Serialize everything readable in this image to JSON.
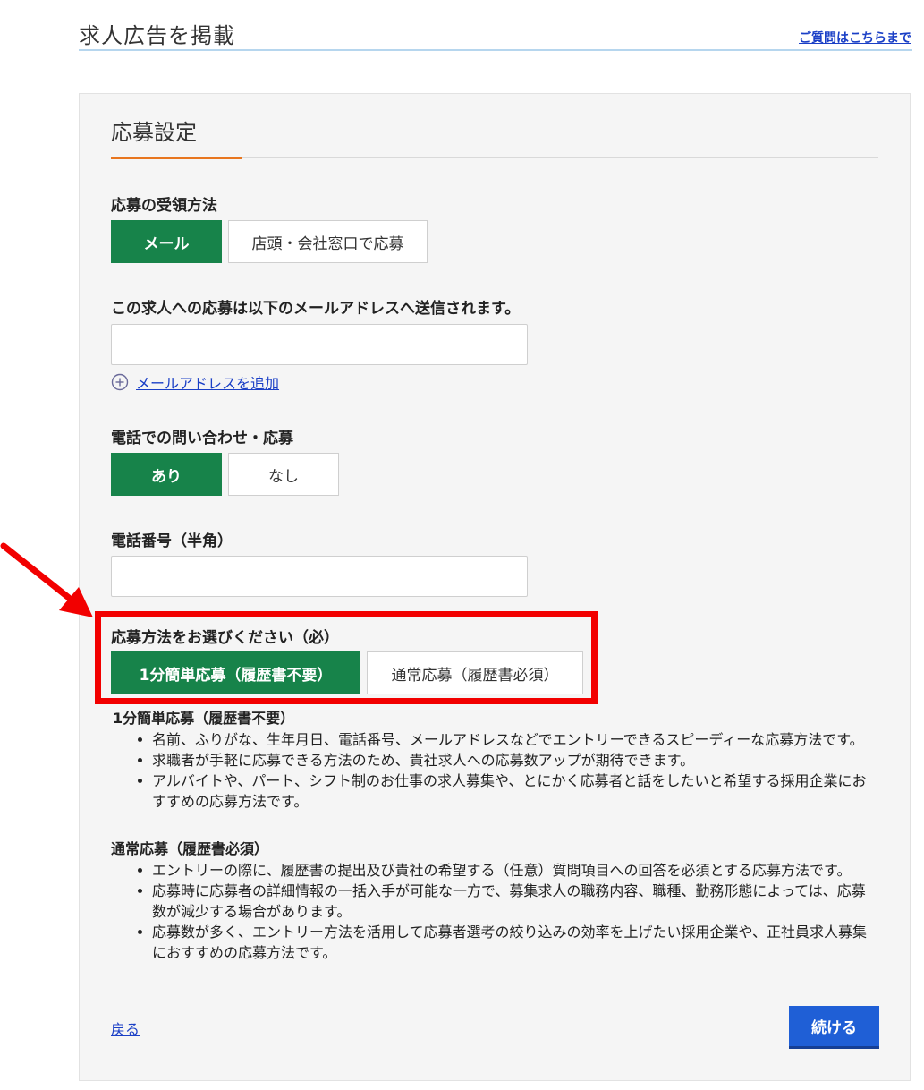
{
  "header": {
    "title": "求人広告を掲載",
    "help_link": "ご質問はこちらまで"
  },
  "section": {
    "title": "応募設定"
  },
  "receive_method": {
    "label": "応募の受領方法",
    "options": [
      "メール",
      "店頭・会社窓口で応募"
    ],
    "selected": "メール"
  },
  "email": {
    "label": "この求人への応募は以下のメールアドレスへ送信されます。",
    "value": "",
    "add_link": "メールアドレスを追加"
  },
  "phone_inquiry": {
    "label": "電話での問い合わせ・応募",
    "options": [
      "あり",
      "なし"
    ],
    "selected": "あり"
  },
  "phone_number": {
    "label": "電話番号（半角）",
    "value": ""
  },
  "apply_method": {
    "label": "応募方法をお選びください（必）",
    "options": [
      "1分簡単応募（履歴書不要）",
      "通常応募（履歴書必須）"
    ],
    "selected": "1分簡単応募（履歴書不要）"
  },
  "descriptions": {
    "easy": {
      "title": "1分簡単応募（履歴書不要）",
      "items": [
        "名前、ふりがな、生年月日、電話番号、メールアドレスなどでエントリーできるスピーディーな応募方法です。",
        "求職者が手軽に応募できる方法のため、貴社求人への応募数アップが期待できます。",
        "アルバイトや、パート、シフト制のお仕事の求人募集や、とにかく応募者と話をしたいと希望する採用企業におすすめの応募方法です。"
      ]
    },
    "normal": {
      "title": "通常応募（履歴書必須）",
      "items": [
        "エントリーの際に、履歴書の提出及び貴社の希望する（任意）質問項目への回答を必須とする応募方法です。",
        "応募時に応募者の詳細情報の一括入手が可能な一方で、募集求人の職務内容、職種、勤務形態によっては、応募数が減少する場合があります。",
        "応募数が多く、エントリー方法を活用して応募者選考の絞り込みの効率を上げたい採用企業や、正社員求人募集におすすめの応募方法です。"
      ]
    }
  },
  "footer": {
    "back": "戻る",
    "continue": "続ける"
  },
  "colors": {
    "selected_green": "#17834a",
    "accent_orange": "#e8761f",
    "link_blue": "#1a3fc6",
    "continue_blue": "#1f5fd6",
    "annotation_red": "#f20000"
  }
}
